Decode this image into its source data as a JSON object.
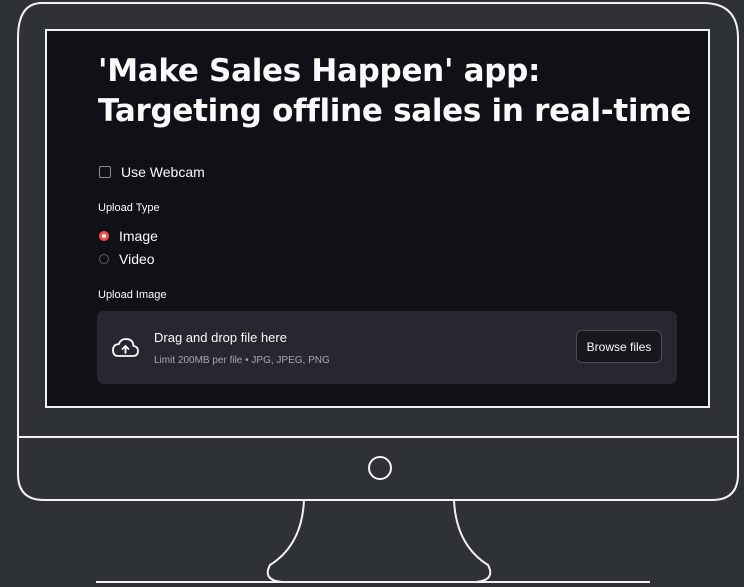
{
  "app": {
    "title": "'Make Sales Happen' app: Targeting offline sales in real-time"
  },
  "webcam": {
    "label": "Use Webcam",
    "checked": false
  },
  "upload_type": {
    "label": "Upload Type",
    "options": [
      {
        "label": "Image",
        "selected": true
      },
      {
        "label": "Video",
        "selected": false
      }
    ]
  },
  "upload_image": {
    "label": "Upload Image",
    "drop_title": "Drag and drop file here",
    "drop_limit": "Limit 200MB per file • JPG, JPEG, PNG",
    "browse_label": "Browse files"
  },
  "colors": {
    "background": "#2e3136",
    "screen": "#0f1116",
    "accent": "#ff4b4b",
    "dropzone": "#262730"
  },
  "icons": [
    "cloud-upload-icon",
    "monitor-power-icon"
  ]
}
